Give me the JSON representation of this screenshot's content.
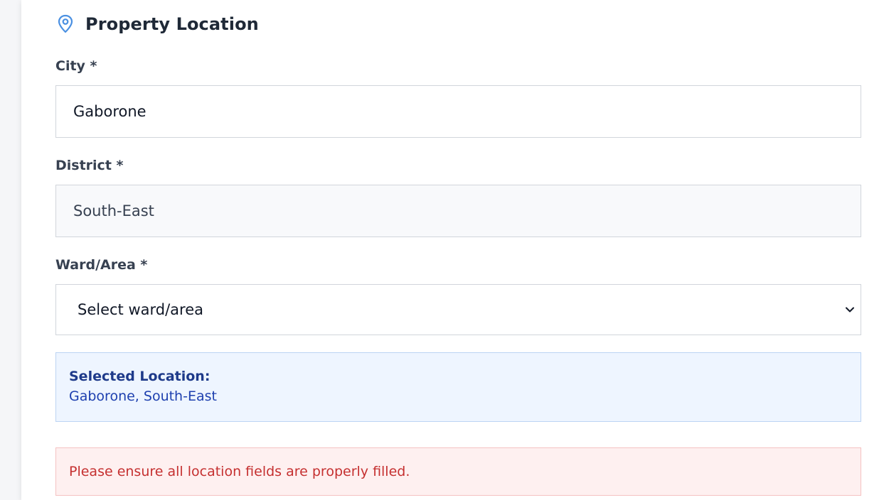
{
  "section": {
    "title": "Property Location",
    "icon": "map-pin-icon",
    "icon_color": "#4a90e2"
  },
  "city": {
    "label": "City *",
    "value": "Gaborone"
  },
  "district": {
    "label": "District *",
    "value": "South-East"
  },
  "ward": {
    "label": "Ward/Area *",
    "selected": "Select ward/area"
  },
  "selected_location": {
    "title": "Selected Location:",
    "value": "Gaborone, South-East"
  },
  "error": {
    "message": "Please ensure all location fields are properly filled."
  },
  "colors": {
    "info_bg": "#eef5ff",
    "info_text": "#1e40af",
    "error_bg": "#fef0f0",
    "error_text": "#c53030"
  }
}
